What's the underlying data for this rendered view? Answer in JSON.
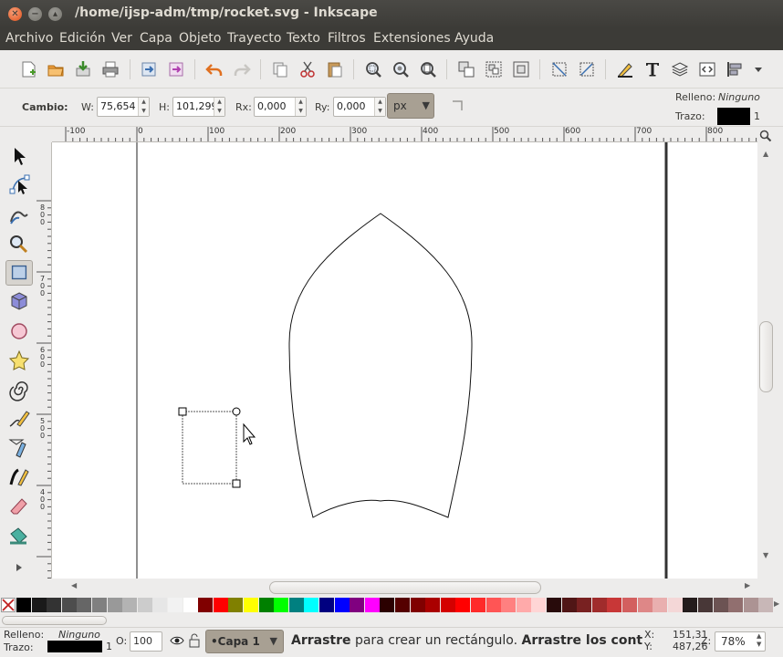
{
  "window": {
    "title": "/home/ijsp-adm/tmp/rocket.svg - Inkscape",
    "close_glyph": "✕",
    "min_glyph": "−",
    "max_glyph": "▴"
  },
  "menu": [
    "Archivo",
    "Edición",
    "Ver",
    "Capa",
    "Objeto",
    "Trayecto",
    "Texto",
    "Filtros",
    "Extensiones",
    "Ayuda"
  ],
  "controls": {
    "tool_label": "Cambio:",
    "w_label": "W:",
    "w_value": "75,654",
    "h_label": "H:",
    "h_value": "101,299",
    "rx_label": "Rx:",
    "rx_value": "0,000",
    "ry_label": "Ry:",
    "ry_value": "0,000",
    "unit": "px",
    "fill_label": "Relleno:",
    "fill_value": "Ninguno",
    "stroke_label": "Trazo:",
    "stroke_width": "1",
    "stroke_color": "#000000"
  },
  "ruler": {
    "h_labels": [
      "-100",
      "0",
      "100",
      "200",
      "300",
      "400",
      "500",
      "600",
      "700",
      "800"
    ],
    "v_labels": [
      "800",
      "700",
      "600",
      "500",
      "400"
    ]
  },
  "icons": {
    "toolbar": [
      "new-document-icon",
      "open-icon",
      "import-icon",
      "print-icon",
      "export-icon",
      "export-bitmap-icon",
      "undo-icon",
      "redo-icon",
      "duplicate-icon",
      "cut-icon",
      "paste-icon",
      "zoom-selection-icon",
      "zoom-drawing-icon",
      "zoom-page-icon",
      "group-icon",
      "ungroup-icon",
      "clone-icon",
      "snap-icon",
      "snap-nodes-icon",
      "fill-stroke-icon",
      "text-icon",
      "layers-icon",
      "xml-editor-icon",
      "align-icon"
    ],
    "tools": [
      "selector-icon",
      "node-tool-icon",
      "tweak-tool-icon",
      "zoom-tool-icon",
      "rectangle-tool-icon",
      "3d-box-tool-icon",
      "ellipse-tool-icon",
      "star-tool-icon",
      "spiral-tool-icon",
      "pencil-tool-icon",
      "pen-tool-icon",
      "calligraphy-tool-icon",
      "eraser-tool-icon",
      "paint-bucket-tool-icon"
    ]
  },
  "palette": [
    "#000000",
    "#1a1a1a",
    "#333333",
    "#4d4d4d",
    "#666666",
    "#808080",
    "#999999",
    "#b3b3b3",
    "#cccccc",
    "#e6e6e6",
    "#f2f2f2",
    "#ffffff",
    "#800000",
    "#ff0000",
    "#808000",
    "#ffff00",
    "#008000",
    "#00ff00",
    "#008080",
    "#00ffff",
    "#000080",
    "#0000ff",
    "#800080",
    "#ff00ff",
    "#2b0000",
    "#550000",
    "#800000",
    "#aa0000",
    "#d40000",
    "#ff0000",
    "#ff2a2a",
    "#ff5555",
    "#ff8080",
    "#ffaaaa",
    "#ffd5d5",
    "#280b0b",
    "#501616",
    "#782121",
    "#a02c2c",
    "#c83737",
    "#d35f5f",
    "#de8787",
    "#e9afaf",
    "#f4d7d7",
    "#241c1c",
    "#483737",
    "#6c5353",
    "#916f6f",
    "#ac9393",
    "#c8b7b7"
  ],
  "status": {
    "fill_label": "Relleno:",
    "fill_value": "Ninguno",
    "stroke_label": "Trazo:",
    "stroke_width": "1",
    "opacity_label": "O:",
    "opacity_value": "100",
    "layer": "•Capa 1",
    "msg_bold1": "Arrastre",
    "msg_normal": " para crear un rectángulo. ",
    "msg_bold2": "Arrastre los control",
    "x_label": "X:",
    "x_value": "151,31",
    "y_label": "Y:",
    "y_value": "487,26",
    "zoom_label": "Z:",
    "zoom_value": "78%"
  }
}
